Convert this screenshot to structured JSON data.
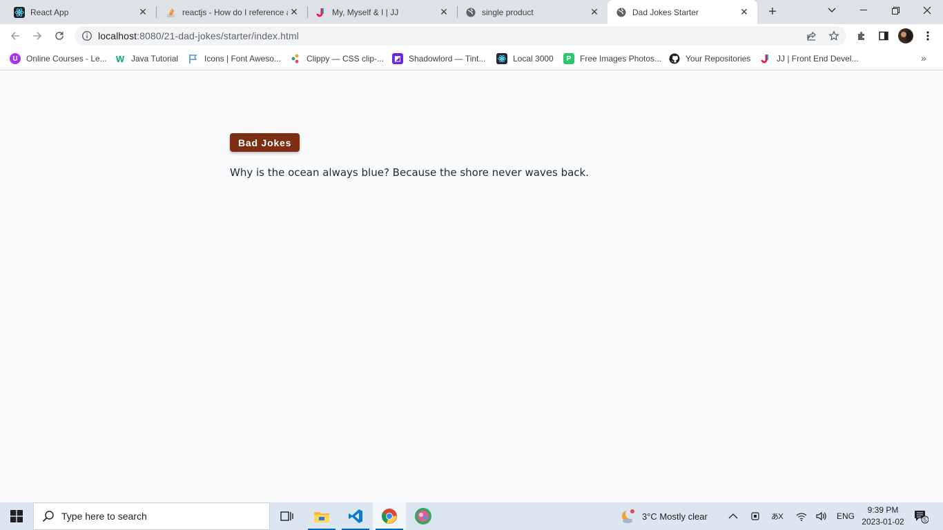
{
  "browser": {
    "tabs": [
      {
        "title": "React App",
        "icon": "react-icon"
      },
      {
        "title": "reactjs - How do I reference a",
        "icon": "stackoverflow-icon"
      },
      {
        "title": "My, Myself & I | JJ",
        "icon": "jj-logo-icon"
      },
      {
        "title": "single product",
        "icon": "globe-icon"
      },
      {
        "title": "Dad Jokes Starter",
        "icon": "globe-icon",
        "active": true
      }
    ],
    "url_host": "localhost",
    "url_path": ":8080/21-dad-jokes/starter/index.html",
    "bookmarks": [
      {
        "label": "Online Courses - Le...",
        "icon": "udemy-icon",
        "color": "#a435f0"
      },
      {
        "label": "Java Tutorial",
        "icon": "w3schools-icon",
        "color": "#04aa6d"
      },
      {
        "label": "Icons | Font Aweso...",
        "icon": "flag-icon",
        "color": "#528dd7"
      },
      {
        "label": "Clippy — CSS clip-...",
        "icon": "clippy-icon",
        "color": "#e9a23b"
      },
      {
        "label": "Shadowlord — Tint...",
        "icon": "shadowlord-icon",
        "color": "#6d28d9"
      },
      {
        "label": "Local 3000",
        "icon": "react-icon",
        "color": "#1f2a36"
      },
      {
        "label": "Free Images Photos...",
        "icon": "pixabay-icon",
        "color": "#2ec66d"
      },
      {
        "label": "Your Repositories",
        "icon": "github-icon",
        "color": "#1b1f23"
      },
      {
        "label": "JJ | Front End Devel...",
        "icon": "jj-logo-icon",
        "color": "#e11d48"
      }
    ]
  },
  "page": {
    "button_label": "Bad Jokes",
    "joke": "Why is the ocean always blue? Because the shore never waves back."
  },
  "taskbar": {
    "search_placeholder": "Type here to search",
    "weather": "3°C  Mostly clear",
    "language": "ENG",
    "time": "9:39 PM",
    "date": "2023-01-02",
    "notifications": "5"
  },
  "colors": {
    "button_bg": "#7c2d12",
    "page_bg": "#f8fafc"
  }
}
